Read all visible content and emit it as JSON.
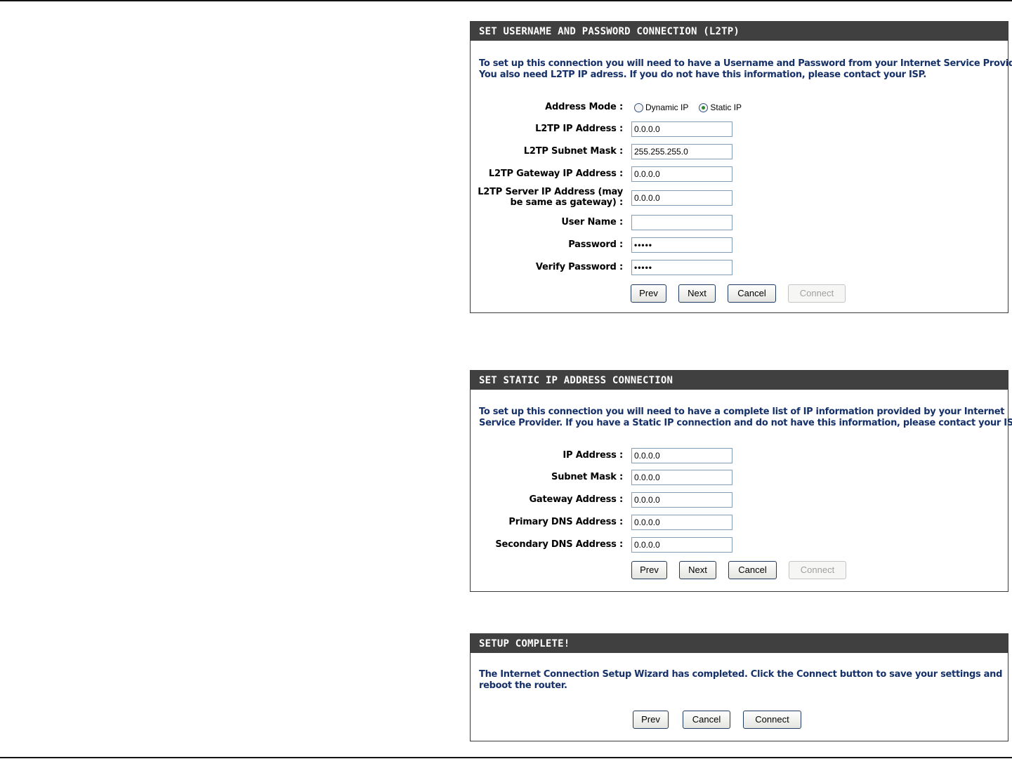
{
  "l2tp": {
    "title": "SET USERNAME AND PASSWORD CONNECTION (L2TP)",
    "desc_line1": "To set up this connection you will need to have a Username and Password from your Internet Service Provider.",
    "desc_line2": "You also need L2TP IP adress. If you do not have this information, please contact your ISP.",
    "address_mode_label": "Address Mode :",
    "address_mode_options": [
      "Dynamic IP",
      "Static IP"
    ],
    "address_mode_selected": "Static IP",
    "ip_label": "L2TP IP Address :",
    "ip_value": "0.0.0.0",
    "mask_label": "L2TP Subnet Mask :",
    "mask_value": "255.255.255.0",
    "gateway_label": "L2TP Gateway IP Address :",
    "gateway_value": "0.0.0.0",
    "server_label_line1": "L2TP Server IP Address (may",
    "server_label_line2": "be same as gateway) :",
    "server_value": "0.0.0.0",
    "username_label": "User Name :",
    "username_value": "",
    "password_label": "Password :",
    "password_value": "•••••",
    "verify_label": "Verify Password :",
    "verify_value": "•••••",
    "buttons": {
      "prev": "Prev",
      "next": "Next",
      "cancel": "Cancel",
      "connect": "Connect"
    }
  },
  "static": {
    "title": "SET STATIC IP ADDRESS CONNECTION",
    "desc_line1": "To set up this connection you will need to have a complete list of IP information provided by your Internet",
    "desc_line2": "Service Provider. If you have a Static IP connection and do not have this information, please contact your ISP.",
    "ip_label": "IP Address :",
    "ip_value": "0.0.0.0",
    "mask_label": "Subnet Mask :",
    "mask_value": "0.0.0.0",
    "gateway_label": "Gateway Address :",
    "gateway_value": "0.0.0.0",
    "dns1_label": "Primary DNS Address :",
    "dns1_value": "0.0.0.0",
    "dns2_label": "Secondary DNS Address :",
    "dns2_value": "0.0.0.0",
    "buttons": {
      "prev": "Prev",
      "next": "Next",
      "cancel": "Cancel",
      "connect": "Connect"
    }
  },
  "complete": {
    "title": "SETUP COMPLETE!",
    "desc_line1": "The Internet Connection Setup Wizard has completed. Click the Connect button to save your settings and",
    "desc_line2": "reboot the router.",
    "buttons": {
      "prev": "Prev",
      "cancel": "Cancel",
      "connect": "Connect"
    }
  }
}
